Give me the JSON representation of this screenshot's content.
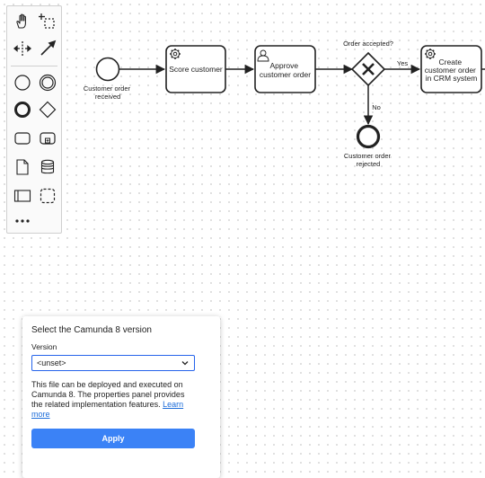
{
  "diagram": {
    "start_event_label": [
      "Customer order",
      "received"
    ],
    "task_score_label": "Score customer",
    "task_approve_label": [
      "Approve",
      "customer order"
    ],
    "gateway_label": "Order accepted?",
    "flow_yes_label": "Yes",
    "flow_no_label": "No",
    "task_create_label": [
      "Create",
      "customer order",
      "in CRM system"
    ],
    "end_event_label": [
      "Customer order",
      "rejected"
    ]
  },
  "palette": {
    "tools": [
      "hand-tool-icon",
      "lasso-tool-icon",
      "space-tool-icon",
      "connect-tool-icon",
      "start-event-icon",
      "intermediate-event-icon",
      "end-event-icon",
      "gateway-icon",
      "task-icon",
      "subprocess-icon",
      "data-object-icon",
      "data-store-icon",
      "pool-icon",
      "group-icon",
      "more-icon"
    ]
  },
  "panel": {
    "title": "Select the Camunda 8 version",
    "version_label": "Version",
    "version_value": "<unset>",
    "description": "This file can be deployed and executed on Camunda 8. The properties panel provides the related implementation features.",
    "learn_more": "Learn more",
    "apply_label": "Apply"
  },
  "colors": {
    "accent": "#3b82f6",
    "link": "#1c6cd9",
    "stroke": "#222222"
  }
}
